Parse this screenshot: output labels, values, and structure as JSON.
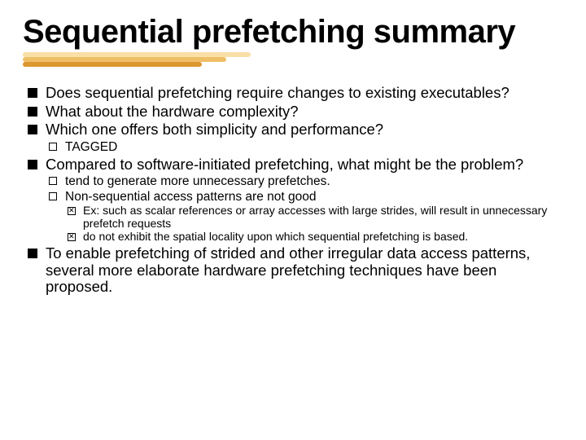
{
  "title": "Sequential prefetching summary",
  "bullets": {
    "b1": "Does sequential prefetching require changes to existing executables?",
    "b2": "What about the hardware complexity?",
    "b3": "Which one offers both simplicity and performance?",
    "b3_sub1": "TAGGED",
    "b4": "Compared to software-initiated prefetching, what might be the problem?",
    "b4_sub1": "tend to generate more unnecessary prefetches.",
    "b4_sub2": "Non-sequential access patterns are not good",
    "b4_sub2_a": "Ex: such as scalar references or array accesses with large strides, will result in unnecessary prefetch requests",
    "b4_sub2_b": "do not exhibit the spatial locality upon which sequential prefetching is based.",
    "b5": "To enable prefetching of strided and other irregular data access patterns, several more elaborate hardware prefetching techniques have been proposed."
  }
}
